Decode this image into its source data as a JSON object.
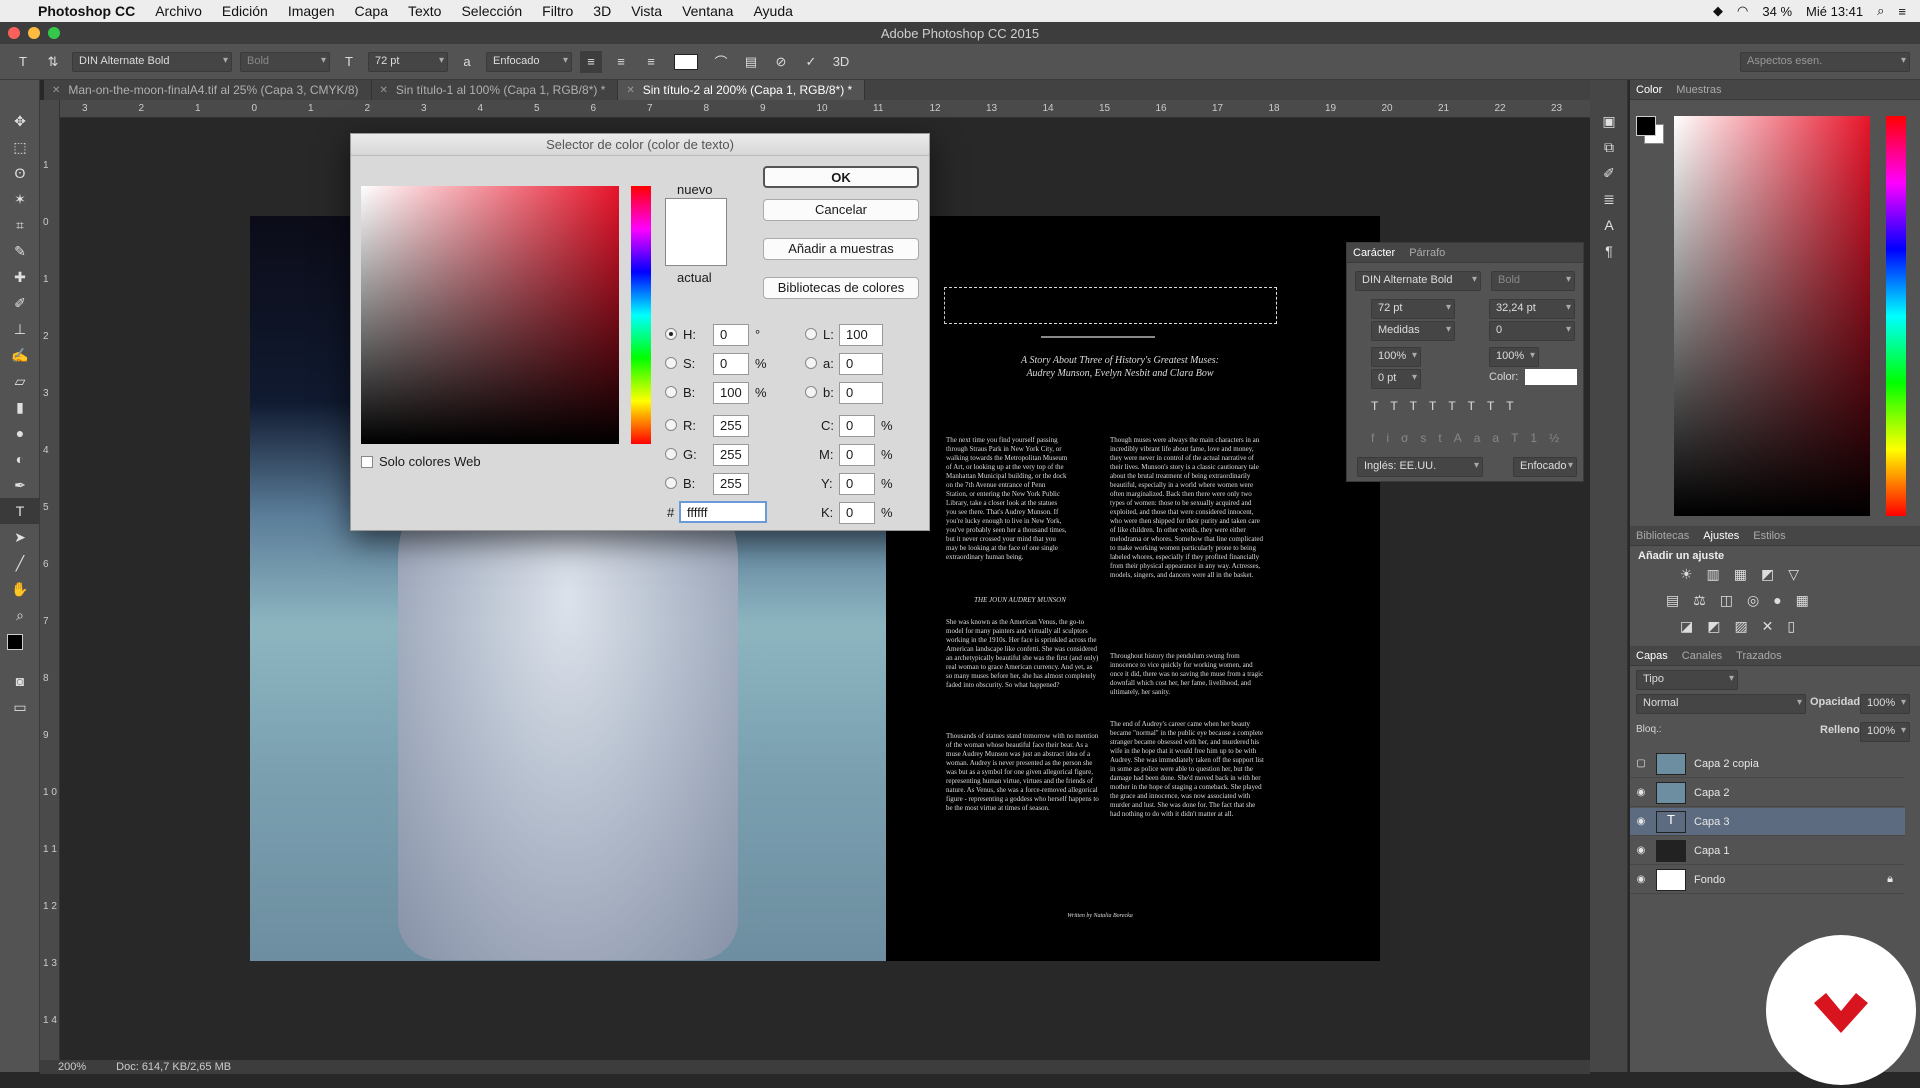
{
  "menubar": {
    "app": "Photoshop CC",
    "items": [
      "Archivo",
      "Edición",
      "Imagen",
      "Capa",
      "Texto",
      "Selección",
      "Filtro",
      "3D",
      "Vista",
      "Ventana",
      "Ayuda"
    ],
    "battery": "34 %",
    "clock": "Mié 13:41"
  },
  "window": {
    "title": "Adobe Photoshop CC 2015"
  },
  "options": {
    "font": "DIN Alternate Bold",
    "style": "Bold",
    "size": "72 pt",
    "antialias": "Enfocado",
    "workspace": "Aspectos esen."
  },
  "tabs": [
    {
      "label": "Man-on-the-moon-finalA4.tif al 25% (Capa 3, CMYK/8)"
    },
    {
      "label": "Sin título-1 al 100% (Capa 1, RGB/8*) *"
    },
    {
      "label": "Sin título-2 al 200% (Capa 1, RGB/8*) *"
    }
  ],
  "ruler": {
    "h": [
      "3",
      "2",
      "1",
      "0",
      "1",
      "2",
      "3",
      "4",
      "5",
      "6",
      "7",
      "8",
      "9",
      "10",
      "11",
      "12",
      "13",
      "14",
      "15",
      "16",
      "17",
      "18",
      "19",
      "20",
      "21",
      "22",
      "23"
    ],
    "v": [
      "1",
      "0",
      "1",
      "2",
      "3",
      "4",
      "5",
      "6",
      "7",
      "8",
      "9",
      "1 0",
      "1 1",
      "1 2",
      "1 3",
      "1 4"
    ]
  },
  "doc": {
    "subtitle_1": "A Story About Three of History's Greatest Muses:",
    "subtitle_2": "Audrey Munson, Evelyn Nesbit and Clara Bow",
    "heading": "THE JOUN AUDREY MUNSON",
    "footer": "Written by Natalia Borecka",
    "text_col_1": "The next time you find yourself passing through Straus Park in New York City, or walking towards the Metropolitan Museum of Art, or looking up at the very top of the Manhattan Municipal building, or the dock on the 7th Avenue entrance of Penn Station, or entering the New York Public Library, take a closer look at the statues you see there. That's Audrey Munson. If you're lucky enough to live in New York, you've probably seen her a thousand times, but it never crossed your mind that you may be looking at the face of one single extraordinary human being.",
    "text_col_2": "Though muses were always the main characters in an incredibly vibrant life about fame, love and money, they were never in control of the actual narrative of their lives. Munson's story is a classic cautionary tale about the brutal treatment of being extraordinarily beautiful, especially in a world where women were often marginalized. Back then there were only two types of women: those to be sexually acquired and exploited, and those that were considered innocent, who were then shipped for their purity and taken care of like children. In other words, they were either melodrama or whores. Somehow that line complicated to make working women particularly prone to being labeled whores, especially if they profited financially from their physical appearance in any way. Actresses, models, singers, and dancers were all in the basket.",
    "text_col_3": "She was known as the American Venus, the go-to model for many painters and virtually all sculptors working in the 1910s. Her face is sprinkled across the American landscape like confetti. She was considered an archetypically beautiful she was the first (and only) real woman to grace American currency. And yet, as so many muses before her, she has almost completely faded into obscurity. So what happened?",
    "text_col_4": "Throughout history the pendulum swung from innocence to vice quickly for working women, and once it did, there was no saving the muse from a tragic downfall which cost her, her fame, livelihood, and ultimately, her sanity.",
    "text_col_5": "Thousands of statues stand tomorrow with no mention of the woman whose beautiful face their bear. As a muse Audrey Munson was just an abstract idea of a woman. Audrey is never presented as the person she was but as a symbol for one given allegorical figure, representing human virtue, virtues and the friends of nature. As Venus, she was a force-removed allegorical figure - representing a goddess who herself happens to be the most virtue at times of season.",
    "text_col_6": "The end of Audrey's career came when her beauty became \"normal\" in the public eye because a complete stranger became obsessed with her, and murdered his wife in the hope that it would free him up to be with Audrey. She was immediately taken off the support list in some as police were able to question her, but the damage had been done. She'd moved back in with her mother in the hope of staging a comeback. She played the grace and innocence, was now associated with murder and lust. She was done for. The fact that she had nothing to do with it didn't matter at all."
  },
  "dialog": {
    "title": "Selector de color (color de texto)",
    "new_label": "nuevo",
    "current_label": "actual",
    "ok": "OK",
    "cancel": "Cancelar",
    "add": "Añadir a muestras",
    "libs": "Bibliotecas de colores",
    "web_only": "Solo colores Web",
    "H": "0",
    "S": "0",
    "B": "100",
    "R": "255",
    "G": "255",
    "Bb": "255",
    "L": "100",
    "a": "0",
    "b": "0",
    "C": "0",
    "M": "0",
    "Y": "0",
    "K": "0",
    "hex": "ffffff",
    "lbl_H": "H:",
    "lbl_S": "S:",
    "lbl_B": "B:",
    "lbl_R": "R:",
    "lbl_G": "G:",
    "lbl_Bb": "B:",
    "lbl_L": "L:",
    "lbl_a": "a:",
    "lbl_b": "b:",
    "lbl_C": "C:",
    "lbl_M": "M:",
    "lbl_Y": "Y:",
    "lbl_K": "K:",
    "deg": "°",
    "pct": "%",
    "hash": "#"
  },
  "charpanel": {
    "tab1": "Carácter",
    "tab2": "Párrafo",
    "font": "DIN Alternate Bold",
    "style": "Bold",
    "size": "72 pt",
    "leading": "32,24 pt",
    "kerning": "Medidas",
    "tracking": "0",
    "vscale": "100%",
    "hscale": "100%",
    "baseline": "0 pt",
    "color_label": "Color:",
    "lang": "Inglés: EE.UU.",
    "aa": "Enfocado"
  },
  "panels": {
    "color_tab": "Color",
    "swatch_tab": "Muestras",
    "lib_tab": "Bibliotecas",
    "adj_tab": "Ajustes",
    "styles_tab": "Estilos",
    "add_adj": "Añadir un ajuste",
    "layers_tab": "Capas",
    "channels_tab": "Canales",
    "paths_tab": "Trazados",
    "kind": "Tipo",
    "blend": "Normal",
    "opacity_label": "Opacidad:",
    "opacity": "100%",
    "lock_label": "Bloq.:",
    "fill_label": "Relleno:",
    "fill": "100%"
  },
  "layers": [
    {
      "name": "Capa 2 copia"
    },
    {
      "name": "Capa 2"
    },
    {
      "name": "Capa 3"
    },
    {
      "name": "Capa 1"
    },
    {
      "name": "Fondo"
    }
  ],
  "status": {
    "zoom": "200%",
    "doc": "Doc: 614,7 KB/2,65 MB"
  }
}
